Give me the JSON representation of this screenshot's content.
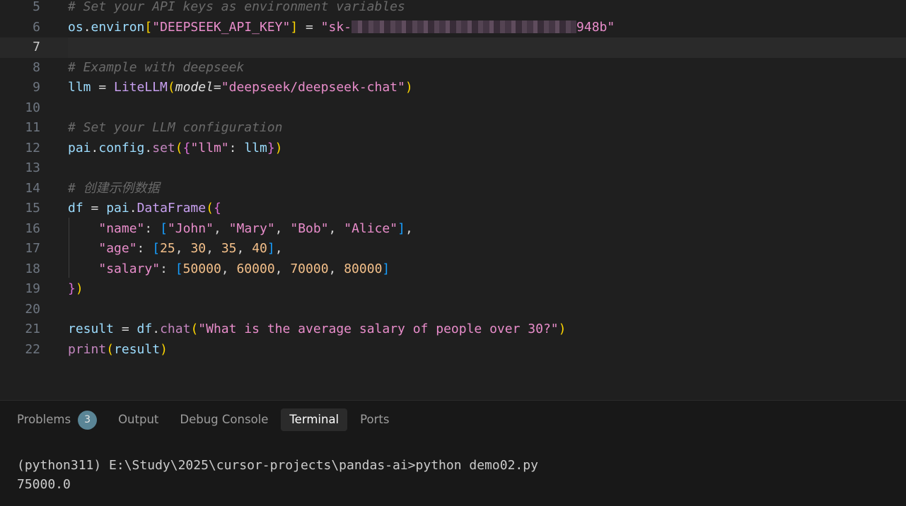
{
  "editor": {
    "lines": [
      {
        "num": "5",
        "tokens": [
          {
            "t": "# Set your API keys as environment variables",
            "c": "cm"
          }
        ]
      },
      {
        "num": "6",
        "tokens": [
          {
            "t": "os",
            "c": "id"
          },
          {
            "t": ".",
            "c": "plain"
          },
          {
            "t": "environ",
            "c": "id"
          },
          {
            "t": "[",
            "c": "br1"
          },
          {
            "t": "\"DEEPSEEK_API_KEY\"",
            "c": "str"
          },
          {
            "t": "]",
            "c": "br1"
          },
          {
            "t": " = ",
            "c": "plain"
          },
          {
            "t": "\"sk-",
            "c": "str"
          },
          {
            "t": "",
            "c": "redacted"
          },
          {
            "t": "948b\"",
            "c": "str"
          }
        ]
      },
      {
        "num": "7",
        "current": true,
        "tokens": []
      },
      {
        "num": "8",
        "tokens": [
          {
            "t": "# Example with deepseek",
            "c": "cm"
          }
        ]
      },
      {
        "num": "9",
        "tokens": [
          {
            "t": "llm",
            "c": "id"
          },
          {
            "t": " = ",
            "c": "plain"
          },
          {
            "t": "LiteLLM",
            "c": "cls"
          },
          {
            "t": "(",
            "c": "br1"
          },
          {
            "t": "model",
            "c": "kw-param"
          },
          {
            "t": "=",
            "c": "plain"
          },
          {
            "t": "\"deepseek/deepseek-chat\"",
            "c": "str"
          },
          {
            "t": ")",
            "c": "br1"
          }
        ]
      },
      {
        "num": "10",
        "tokens": []
      },
      {
        "num": "11",
        "tokens": [
          {
            "t": "# Set your LLM configuration",
            "c": "cm"
          }
        ]
      },
      {
        "num": "12",
        "tokens": [
          {
            "t": "pai",
            "c": "id"
          },
          {
            "t": ".",
            "c": "plain"
          },
          {
            "t": "config",
            "c": "id"
          },
          {
            "t": ".",
            "c": "plain"
          },
          {
            "t": "set",
            "c": "fn"
          },
          {
            "t": "(",
            "c": "br1"
          },
          {
            "t": "{",
            "c": "br2"
          },
          {
            "t": "\"llm\"",
            "c": "str"
          },
          {
            "t": ": ",
            "c": "plain"
          },
          {
            "t": "llm",
            "c": "id"
          },
          {
            "t": "}",
            "c": "br2"
          },
          {
            "t": ")",
            "c": "br1"
          }
        ]
      },
      {
        "num": "13",
        "tokens": []
      },
      {
        "num": "14",
        "tokens": [
          {
            "t": "# 创建示例数据",
            "c": "cm"
          }
        ]
      },
      {
        "num": "15",
        "tokens": [
          {
            "t": "df",
            "c": "id"
          },
          {
            "t": " = ",
            "c": "plain"
          },
          {
            "t": "pai",
            "c": "id"
          },
          {
            "t": ".",
            "c": "plain"
          },
          {
            "t": "DataFrame",
            "c": "cls"
          },
          {
            "t": "(",
            "c": "br1"
          },
          {
            "t": "{",
            "c": "br2"
          }
        ]
      },
      {
        "num": "16",
        "tokens": [
          {
            "t": "    ",
            "c": "plain"
          },
          {
            "t": "\"name\"",
            "c": "key"
          },
          {
            "t": ": ",
            "c": "plain"
          },
          {
            "t": "[",
            "c": "br3"
          },
          {
            "t": "\"John\"",
            "c": "str"
          },
          {
            "t": ", ",
            "c": "plain"
          },
          {
            "t": "\"Mary\"",
            "c": "str"
          },
          {
            "t": ", ",
            "c": "plain"
          },
          {
            "t": "\"Bob\"",
            "c": "str"
          },
          {
            "t": ", ",
            "c": "plain"
          },
          {
            "t": "\"Alice\"",
            "c": "str"
          },
          {
            "t": "]",
            "c": "br3"
          },
          {
            "t": ",",
            "c": "plain"
          }
        ]
      },
      {
        "num": "17",
        "tokens": [
          {
            "t": "    ",
            "c": "plain"
          },
          {
            "t": "\"age\"",
            "c": "key"
          },
          {
            "t": ": ",
            "c": "plain"
          },
          {
            "t": "[",
            "c": "br3"
          },
          {
            "t": "25",
            "c": "num"
          },
          {
            "t": ", ",
            "c": "plain"
          },
          {
            "t": "30",
            "c": "num"
          },
          {
            "t": ", ",
            "c": "plain"
          },
          {
            "t": "35",
            "c": "num"
          },
          {
            "t": ", ",
            "c": "plain"
          },
          {
            "t": "40",
            "c": "num"
          },
          {
            "t": "]",
            "c": "br3"
          },
          {
            "t": ",",
            "c": "plain"
          }
        ]
      },
      {
        "num": "18",
        "tokens": [
          {
            "t": "    ",
            "c": "plain"
          },
          {
            "t": "\"salary\"",
            "c": "key"
          },
          {
            "t": ": ",
            "c": "plain"
          },
          {
            "t": "[",
            "c": "br3"
          },
          {
            "t": "50000",
            "c": "num"
          },
          {
            "t": ", ",
            "c": "plain"
          },
          {
            "t": "60000",
            "c": "num"
          },
          {
            "t": ", ",
            "c": "plain"
          },
          {
            "t": "70000",
            "c": "num"
          },
          {
            "t": ", ",
            "c": "plain"
          },
          {
            "t": "80000",
            "c": "num"
          },
          {
            "t": "]",
            "c": "br3"
          }
        ]
      },
      {
        "num": "19",
        "tokens": [
          {
            "t": "}",
            "c": "br2"
          },
          {
            "t": ")",
            "c": "br1"
          }
        ]
      },
      {
        "num": "20",
        "tokens": []
      },
      {
        "num": "21",
        "tokens": [
          {
            "t": "result",
            "c": "id"
          },
          {
            "t": " = ",
            "c": "plain"
          },
          {
            "t": "df",
            "c": "id"
          },
          {
            "t": ".",
            "c": "plain"
          },
          {
            "t": "chat",
            "c": "fn"
          },
          {
            "t": "(",
            "c": "br1"
          },
          {
            "t": "\"What is the average salary of people over 30?\"",
            "c": "str"
          },
          {
            "t": ")",
            "c": "br1"
          }
        ]
      },
      {
        "num": "22",
        "tokens": [
          {
            "t": "print",
            "c": "fn"
          },
          {
            "t": "(",
            "c": "br1"
          },
          {
            "t": "result",
            "c": "id"
          },
          {
            "t": ")",
            "c": "br1"
          }
        ]
      }
    ]
  },
  "panel": {
    "tabs": [
      {
        "label": "Problems",
        "badge": "3",
        "active": false
      },
      {
        "label": "Output",
        "active": false
      },
      {
        "label": "Debug Console",
        "active": false
      },
      {
        "label": "Terminal",
        "active": true
      },
      {
        "label": "Ports",
        "active": false
      }
    ],
    "terminal_lines": [
      "(python311) E:\\Study\\2025\\cursor-projects\\pandas-ai>python demo02.py",
      "75000.0"
    ]
  }
}
